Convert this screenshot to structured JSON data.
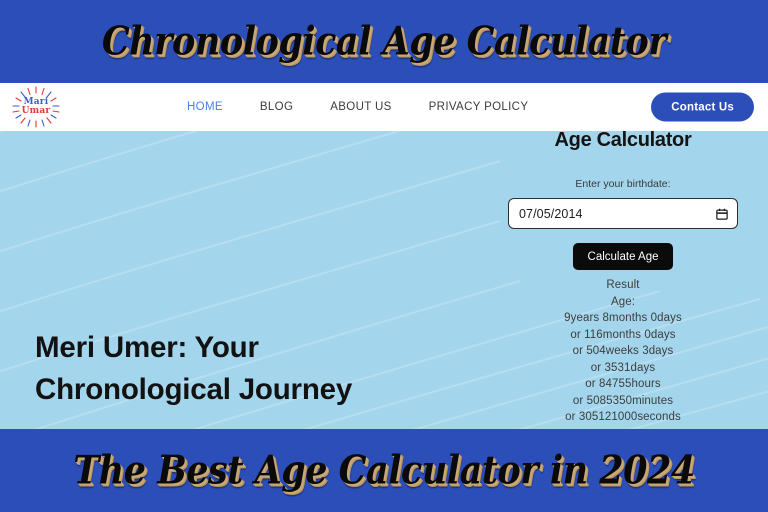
{
  "top_banner": {
    "text": "Chronological Age Calculator"
  },
  "bottom_banner": {
    "text": "The Best Age Calculator in 2024"
  },
  "colors": {
    "banner_blue": "#2b4eb8",
    "hero_blue": "#a3d5ec",
    "nav_active": "#4a7ef0",
    "logo_blue": "#3b5bd0",
    "logo_red": "#e03a35",
    "button_black": "#0b0b0b",
    "banner_text_shadow": "#c9a876"
  },
  "navbar": {
    "logo": {
      "line1": "Mari",
      "line2": "Umar",
      "icon": "sunburst-icon"
    },
    "links": [
      {
        "label": "HOME",
        "active": true
      },
      {
        "label": "BLOG",
        "active": false
      },
      {
        "label": "ABOUT US",
        "active": false
      },
      {
        "label": "PRIVACY POLICY",
        "active": false
      }
    ],
    "cta": {
      "label": "Contact Us"
    }
  },
  "hero": {
    "heading": "Meri Umer: Your Chronological Journey"
  },
  "calculator": {
    "title": "Age Calculator",
    "birthdate_label": "Enter your birthdate:",
    "birthdate_value": "07/05/2014",
    "birthdate_placeholder": "mm/dd/yyyy",
    "calendar_icon": "calendar-icon",
    "calculate_label": "Calculate Age",
    "result_heading": "Result",
    "age_label": "Age:",
    "results": [
      "9years 8months 0days",
      "or 116months 0days",
      "or 504weeks 3days",
      "or 3531days",
      "or 84755hours",
      "or 5085350minutes",
      "or 305121000seconds"
    ]
  }
}
